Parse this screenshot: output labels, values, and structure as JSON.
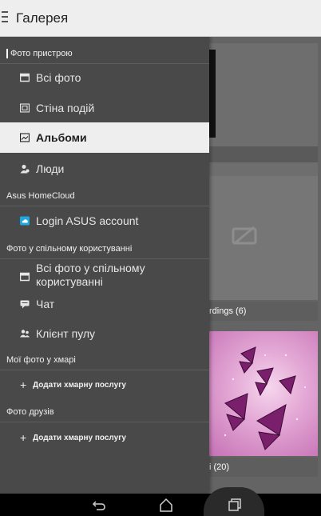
{
  "appbar": {
    "title": "Галерея"
  },
  "drawer": {
    "sections": [
      {
        "header": "Фото пристрою"
      },
      {
        "header": "Asus HomeCloud"
      },
      {
        "header": "Фото у спільному користуванні"
      },
      {
        "header": "Мої фото у хмарі"
      },
      {
        "header": "Фото друзів"
      }
    ],
    "items": {
      "all_photos": "Всі фото",
      "event_wall": "Стіна подій",
      "albums": "Альбоми",
      "people": "Люди",
      "asus_login": "Login ASUS account",
      "shared_all": "Всі фото у спільному користуванні",
      "chat": "Чат",
      "pool_client": "Клієнт пулу",
      "add_cloud_1": "Додати хмарну послугу",
      "add_cloud_2": "Додати хмарну послугу"
    },
    "add_symbol": "+"
  },
  "gallery": {
    "caption_recordings": "rdings (6)",
    "caption_third": "i (20)"
  },
  "colors": {
    "drawer_bg": "#494949",
    "active_bg": "#eeeeee",
    "appbar_bg": "#eeeeee",
    "cloud_accent": "#1fa8e0"
  },
  "icons": [
    "menu-icon",
    "photo-icon",
    "calendar-icon",
    "album-icon",
    "people-icon",
    "cloud-icon",
    "shared-photo-icon",
    "chat-icon",
    "pool-client-icon",
    "back-icon",
    "home-icon",
    "recent-apps-icon",
    "no-photo-icon"
  ]
}
